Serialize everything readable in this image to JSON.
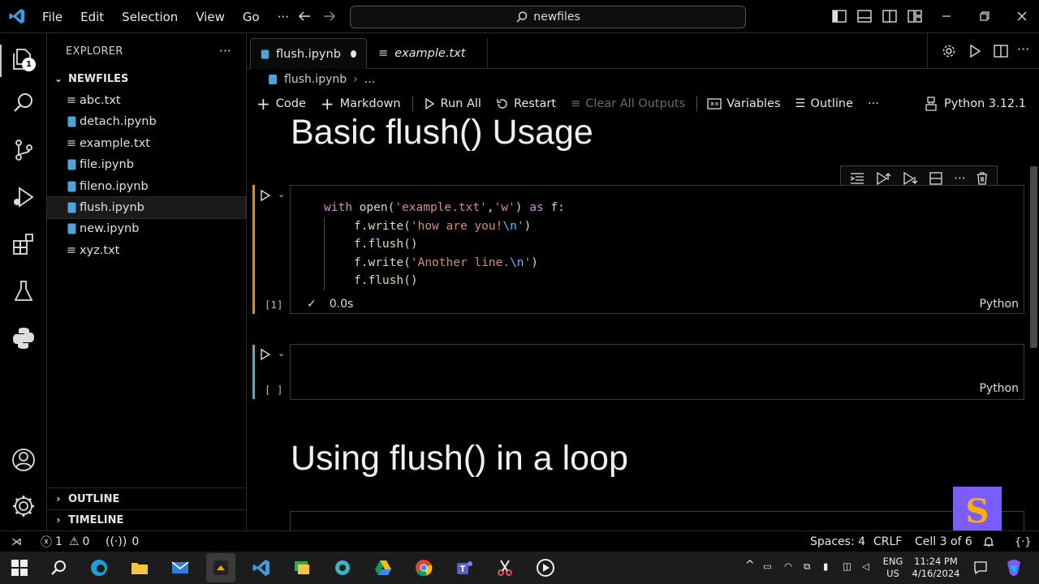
{
  "titlebar": {
    "menu": [
      "File",
      "Edit",
      "Selection",
      "View",
      "Go",
      "···"
    ],
    "search_text": "newfiles"
  },
  "activity_bar": {
    "explorer_badge": "1",
    "icons": [
      "files-icon",
      "search-icon",
      "source-control-icon",
      "run-debug-icon",
      "extensions-icon",
      "testing-icon",
      "python-icon",
      "account-icon",
      "settings-gear-icon"
    ]
  },
  "sidebar": {
    "title": "EXPLORER",
    "more": "···",
    "folder": "NEWFILES",
    "files": [
      {
        "name": "abc.txt",
        "type": "txt"
      },
      {
        "name": "detach.ipynb",
        "type": "ipynb"
      },
      {
        "name": "example.txt",
        "type": "txt"
      },
      {
        "name": "file.ipynb",
        "type": "ipynb"
      },
      {
        "name": "fileno.ipynb",
        "type": "ipynb"
      },
      {
        "name": "flush.ipynb",
        "type": "ipynb",
        "selected": true
      },
      {
        "name": "new.ipynb",
        "type": "ipynb"
      },
      {
        "name": "xyz.txt",
        "type": "txt"
      }
    ],
    "outline": "OUTLINE",
    "timeline": "TIMELINE"
  },
  "tabs": [
    {
      "label": "flush.ipynb",
      "active": true,
      "dirty": true
    },
    {
      "label": "example.txt",
      "active": false,
      "italic": true
    }
  ],
  "breadcrumb": {
    "file": "flush.ipynb",
    "rest": "..."
  },
  "notebook_toolbar": {
    "code": "Code",
    "markdown": "Markdown",
    "run_all": "Run All",
    "restart": "Restart",
    "clear_outputs": "Clear All Outputs",
    "variables": "Variables",
    "outline": "Outline",
    "more": "···",
    "kernel": "Python 3.12.1"
  },
  "cells": {
    "heading1": "Basic flush() Usage",
    "code1": {
      "index": "[1]",
      "exec_time": "0.0s",
      "lang": "Python",
      "lines": {
        "l1_kw": "with",
        "l1_fn": "open",
        "l1_p1": "(",
        "l1_s1": "'example.txt'",
        "l1_c": ",",
        "l1_s2": "'w'",
        "l1_p2": ")",
        "l1_as": "as",
        "l1_f": "f:",
        "l2_obj": "f.",
        "l2_fn": "write",
        "l2_p1": "(",
        "l2_s": "'how are you!",
        "l2_e": "\\n",
        "l2_q": "'",
        "l2_p2": ")",
        "l3_obj": "f.",
        "l3_fn": "flush",
        "l3_p": "()",
        "l4_obj": "f.",
        "l4_fn": "write",
        "l4_p1": "(",
        "l4_s": "'Another line.",
        "l4_e": "\\n",
        "l4_q": "'",
        "l4_p2": ")",
        "l5_obj": "f.",
        "l5_fn": "flush",
        "l5_p": "()"
      }
    },
    "code2": {
      "index": "[ ]",
      "lang": "Python"
    },
    "heading2": "Using flush() in a loop"
  },
  "statusbar": {
    "errors": "1",
    "warnings": "0",
    "ports": "0",
    "spaces": "Spaces: 4",
    "eol": "CRLF",
    "cell": "Cell 3 of 6"
  },
  "taskbar": {
    "lang_top": "ENG",
    "lang_bottom": "US",
    "time": "11:24 PM",
    "date": "4/16/2024",
    "tray_caret": "^"
  },
  "watermark": "S",
  "colors": {
    "accent_bar": "#e08a2e",
    "cell_bar_idle": "#4fb0c6",
    "watermark_bg": "#7a5cff"
  }
}
